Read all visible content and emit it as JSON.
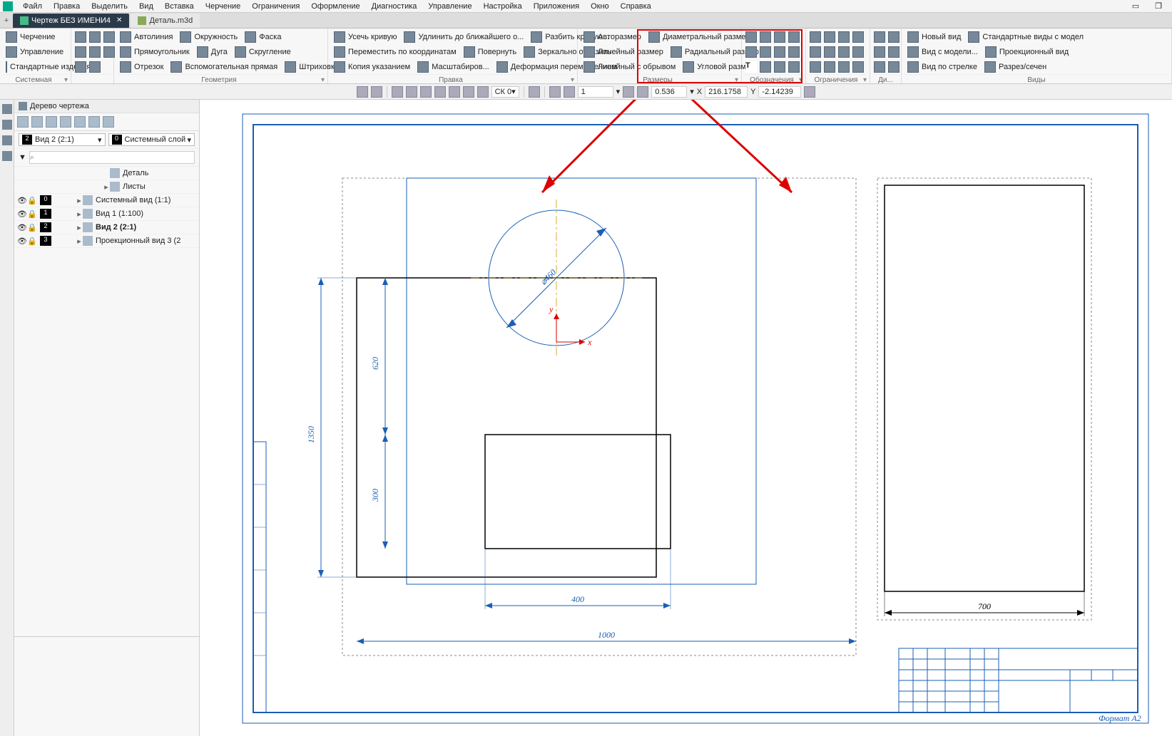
{
  "menu": {
    "items": [
      "Файл",
      "Правка",
      "Выделить",
      "Вид",
      "Вставка",
      "Черчение",
      "Ограничения",
      "Оформление",
      "Диагностика",
      "Управление",
      "Настройка",
      "Приложения",
      "Окно",
      "Справка"
    ]
  },
  "tabs": [
    {
      "label": "Чертеж БЕЗ ИМЕНИ4",
      "active": true
    },
    {
      "label": "Деталь.m3d",
      "active": false
    }
  ],
  "ribbon": {
    "g1": {
      "items": [
        "Черчение",
        "Управление",
        "Стандартные изделия"
      ],
      "label": "Системная"
    },
    "g2": {
      "label": "Геометрия",
      "items": [
        [
          "Автолиния",
          "Окружность",
          "Фаска"
        ],
        [
          "Прямоугольник",
          "Дуга",
          "Скругление"
        ],
        [
          "Отрезок",
          "Вспомогательная прямая",
          "Штриховка"
        ]
      ]
    },
    "g3": {
      "label": "Правка",
      "items": [
        [
          "Усечь кривую",
          "Удлинить до ближайшего о...",
          "Разбить кривую..."
        ],
        [
          "Переместить по координатам",
          "Повернуть",
          "Зеркально отразить"
        ],
        [
          "Копия указанием",
          "Масштабиров...",
          "Деформация перемещением"
        ]
      ]
    },
    "g4": {
      "label": "Размеры",
      "items": [
        [
          "Авторазмер",
          "Диаметральный размер"
        ],
        [
          "Линейный размер",
          "Радиальный размер"
        ],
        [
          "Линейный с обрывом",
          "Угловой размер"
        ]
      ]
    },
    "g5": {
      "label": "Обозначения"
    },
    "g6": {
      "label": "Ограничения"
    },
    "g7": {
      "label": "Ди..."
    },
    "g8": {
      "label": "Виды",
      "items": [
        [
          "Новый вид",
          "Стандартные виды с модел"
        ],
        [
          "Вид с модели...",
          "Проекционный вид"
        ],
        [
          "Вид по стрелке",
          "Разрез/сечен"
        ]
      ]
    }
  },
  "status": {
    "ck": "СК 0",
    "step": "1",
    "zoom": "0.536",
    "x_label": "X",
    "x": "216.1758",
    "y_label": "Y",
    "y": "-2.14239"
  },
  "side": {
    "title": "Дерево чертежа",
    "view_sel": {
      "num": "2",
      "label": "Вид 2 (2:1)"
    },
    "layer_sel": {
      "num": "0",
      "label": "Системный слой"
    },
    "detail": "Деталь",
    "sheets": "Листы",
    "rows": [
      {
        "num": "0",
        "label": "Системный вид (1:1)"
      },
      {
        "num": "1",
        "label": "Вид 1 (1:100)"
      },
      {
        "num": "2",
        "label": "Вид 2 (2:1)",
        "bold": true
      },
      {
        "num": "3",
        "label": "Проекционный вид 3 (2"
      }
    ]
  },
  "dims": {
    "d1": "1350",
    "d2": "620",
    "d3": "300",
    "d4": "400",
    "d5": "1000",
    "d6": "700",
    "circ": "⌀460"
  },
  "stamp_footer": "Формат   А2"
}
